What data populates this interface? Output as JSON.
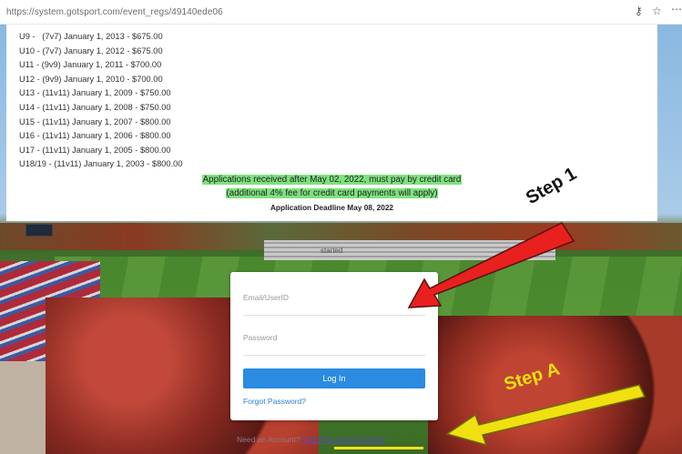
{
  "browser": {
    "url": "https://system.gotsport.com/event_regs/49140ede06",
    "icons": [
      "key-icon",
      "favorites-add-icon",
      "more-icon"
    ]
  },
  "fees": [
    {
      "division": "U9",
      "format": "(7v7)",
      "birth_date": "January 1, 2013",
      "fee": "$675.00",
      "text": "U9 -   (7v7) January 1, 2013 - $675.00"
    },
    {
      "division": "U10",
      "format": "(7v7)",
      "birth_date": "January 1, 2012",
      "fee": "$675.00",
      "text": "U10 - (7v7) January 1, 2012 - $675.00"
    },
    {
      "division": "U11",
      "format": "(9v9)",
      "birth_date": "January 1, 2011",
      "fee": "$700.00",
      "text": "U11 - (9v9) January 1, 2011 - $700.00"
    },
    {
      "division": "U12",
      "format": "(9v9)",
      "birth_date": "January 1, 2010",
      "fee": "$700.00",
      "text": "U12 - (9v9) January 1, 2010 - $700.00"
    },
    {
      "division": "U13",
      "format": "(11v11)",
      "birth_date": "January 1, 2009",
      "fee": "$750.00",
      "text": "U13 - (11v11) January 1, 2009 - $750.00"
    },
    {
      "division": "U14",
      "format": "(11v11)",
      "birth_date": "January 1, 2008",
      "fee": "$750.00",
      "text": "U14 - (11v11) January 1, 2008 - $750.00"
    },
    {
      "division": "U15",
      "format": "(11v11)",
      "birth_date": "January 1, 2007",
      "fee": "$800.00",
      "text": "U15 - (11v11) January 1, 2007 - $800.00"
    },
    {
      "division": "U16",
      "format": "(11v11)",
      "birth_date": "January 1, 2006",
      "fee": "$800.00",
      "text": "U16 - (11v11) January 1, 2006 - $800.00"
    },
    {
      "division": "U17",
      "format": "(11v11)",
      "birth_date": "January 1, 2005",
      "fee": "$800.00",
      "text": "U17 - (11v11) January 1, 2005 - $800.00"
    },
    {
      "division": "U18/19",
      "format": "(11v11)",
      "birth_date": "January 1, 2003",
      "fee": "$800.00",
      "text": "U18/19 - (11v11) January 1, 2003 - $800.00"
    }
  ],
  "notice": {
    "line1": "Applications received after May 02, 2022, must pay by credit card",
    "line2": "(additional 4% fee for credit card payments will apply)",
    "deadline": "Application Deadline May 08, 2022",
    "highlight_color": "#7ee27e"
  },
  "background_text": "started",
  "login": {
    "email_placeholder": "Email/UserID",
    "password_placeholder": "Password",
    "login_button": "Log In",
    "forgot_password": "Forgot Password?",
    "button_color": "#2a8be0"
  },
  "footer": {
    "prefix": "Need an Account?",
    "link": "CREATE AN ACCOUNT"
  },
  "annotations": {
    "step1": "Step 1",
    "stepA": "Step A",
    "step1_arrow_color": "#e8201e",
    "stepA_arrow_color": "#f0e010"
  }
}
